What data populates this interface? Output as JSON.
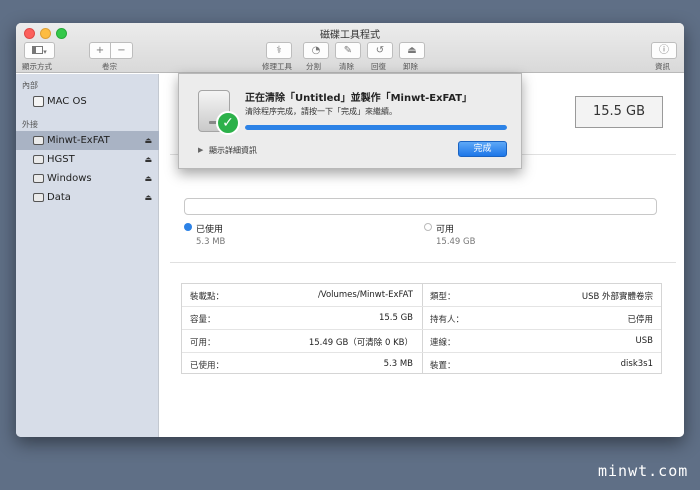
{
  "window": {
    "title": "磁碟工具程式"
  },
  "toolbar": {
    "view_label": "顯示方式",
    "volume_label": "卷宗",
    "add_glyph": "+",
    "remove_glyph": "−",
    "first_aid_label": "修理工具",
    "partition_label": "分割",
    "erase_label": "清除",
    "restore_label": "回復",
    "unmount_label": "卸除",
    "info_label": "資訊"
  },
  "sidebar": {
    "internal_header": "內部",
    "external_header": "外接",
    "items": [
      {
        "label": "MAC OS",
        "section": "internal",
        "eject": false,
        "selected": false
      },
      {
        "label": "Minwt-ExFAT",
        "section": "external",
        "eject": true,
        "selected": true
      },
      {
        "label": "HGST",
        "section": "external",
        "eject": true,
        "selected": false
      },
      {
        "label": "Windows",
        "section": "external",
        "eject": true,
        "selected": false
      },
      {
        "label": "Data",
        "section": "external",
        "eject": true,
        "selected": false
      }
    ],
    "eject_glyph": "⏏"
  },
  "main": {
    "capacity_display": "15.5 GB",
    "used": {
      "label": "已使用",
      "value": "5.3 MB",
      "color": "#2c82e6"
    },
    "available": {
      "label": "可用",
      "value": "15.49 GB",
      "color": "#ffffff"
    },
    "info": {
      "mount_point_key": "裝載點：",
      "mount_point_value": "/Volumes/Minwt-ExFAT",
      "capacity_key": "容量：",
      "capacity_value": "15.5 GB",
      "available_key": "可用：",
      "available_value": "15.49 GB（可清除 0 KB）",
      "used_key": "已使用：",
      "used_value": "5.3 MB",
      "type_key": "類型：",
      "type_value": "USB 外部實體卷宗",
      "owners_key": "持有人：",
      "owners_value": "已停用",
      "connection_key": "連線：",
      "connection_value": "USB",
      "device_key": "裝置：",
      "device_value": "disk3s1"
    }
  },
  "sheet": {
    "title": "正在清除「Untitled」並製作「Minwt-ExFAT」",
    "subtitle": "清除程序完成，請按一下「完成」來繼續。",
    "progress": 1.0,
    "show_details_label": "顯示詳細資訊",
    "done_label": "完成",
    "accent_color": "#2c82e6"
  },
  "watermark": "minwt.com"
}
